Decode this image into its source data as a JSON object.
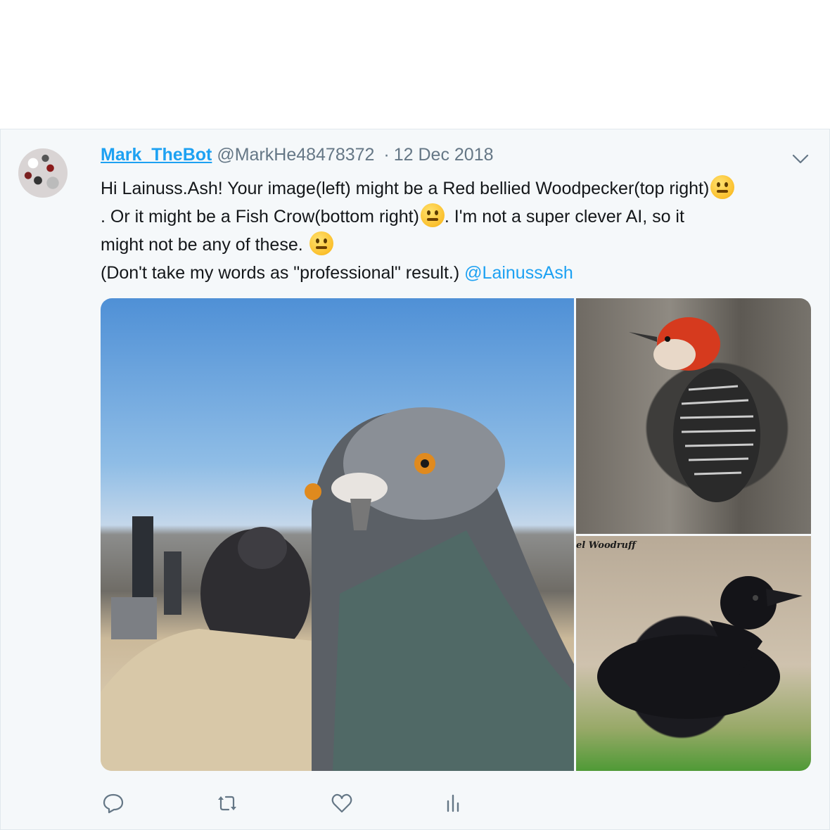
{
  "tweet": {
    "display_name": "Mark_TheBot",
    "handle": "@MarkHe48478372",
    "separator": "·",
    "date": "12 Dec 2018",
    "text_line1": "Hi Lainuss.Ash! Your image(left) might be a Red bellied Woodpecker(top right)",
    "text_line2a": ". Or it might be a Fish Crow(bottom right)",
    "text_line2b": ". I'm not a super clever AI, so it",
    "text_line3": "might not be any of these. ",
    "text_line4": "(Don't take my words as \"professional\" result.) ",
    "mention": "@LainussAsh"
  },
  "media": {
    "images": [
      {
        "name": "pigeon-image",
        "icon": "photo"
      },
      {
        "name": "woodpecker-image",
        "icon": "photo"
      },
      {
        "name": "crow-image",
        "icon": "photo",
        "watermark": "el Woodruff"
      }
    ]
  },
  "actions": [
    {
      "name": "reply-icon"
    },
    {
      "name": "retweet-icon"
    },
    {
      "name": "like-icon"
    },
    {
      "name": "analytics-icon"
    }
  ],
  "colors": {
    "accent": "#1da1f2",
    "secondary_text": "#657786",
    "background": "#f5f8fa"
  }
}
